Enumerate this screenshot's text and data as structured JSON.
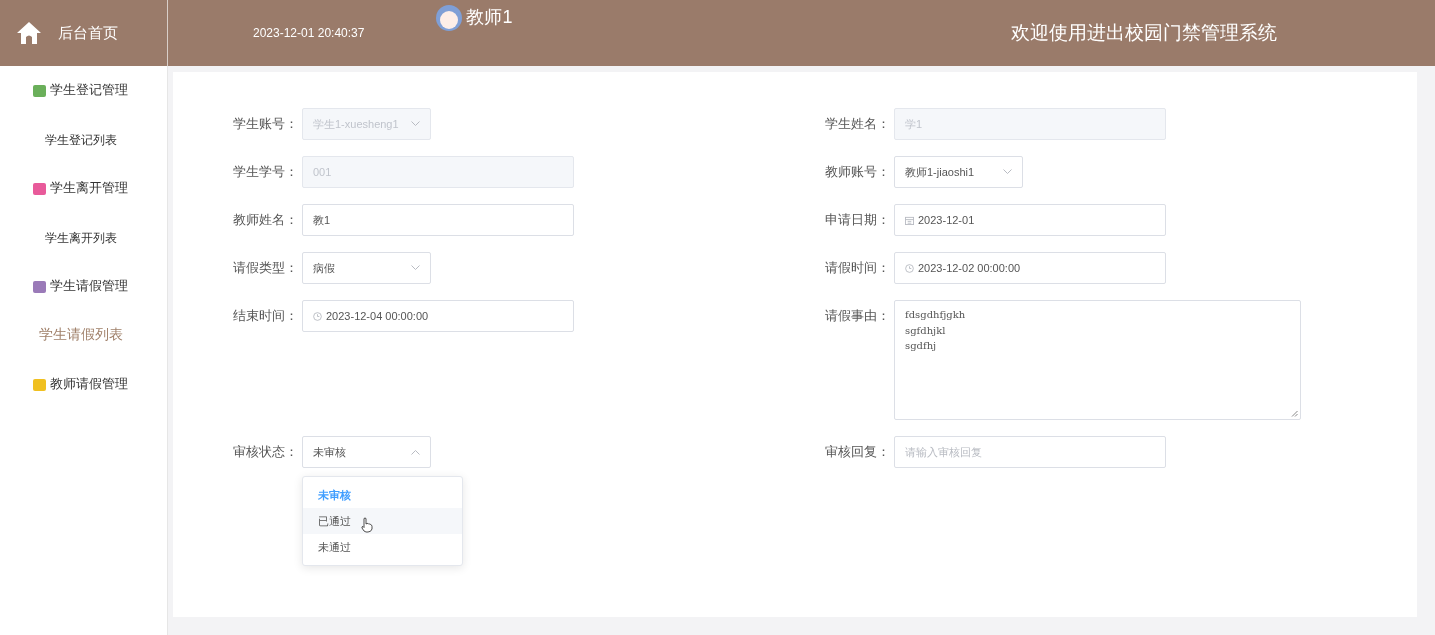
{
  "header": {
    "home_label": "后台首页",
    "datetime": "2023-12-01 20:40:37",
    "user": "教师1",
    "title": "欢迎使用进出校园门禁管理系统"
  },
  "sidebar": {
    "items": [
      {
        "label": "学生登记管理",
        "color": "#6aaf5a",
        "children": [
          {
            "label": "学生登记列表",
            "selected": false
          }
        ]
      },
      {
        "label": "学生离开管理",
        "color": "#e85a9a",
        "children": [
          {
            "label": "学生离开列表",
            "selected": false
          }
        ]
      },
      {
        "label": "学生请假管理",
        "color": "#9a7ab8",
        "children": [
          {
            "label": "学生请假列表",
            "selected": true
          }
        ]
      },
      {
        "label": "教师请假管理",
        "color": "#f0c020"
      }
    ]
  },
  "form": {
    "rows": [
      {
        "left": {
          "label": "学生账号：",
          "kind": "select",
          "value": "学生1-xuesheng1",
          "disabled": true
        },
        "right": {
          "label": "学生姓名：",
          "kind": "input",
          "value": "学1",
          "disabled": true
        }
      },
      {
        "left": {
          "label": "学生学号：",
          "kind": "input",
          "value": "001",
          "disabled": true
        },
        "right": {
          "label": "教师账号：",
          "kind": "select",
          "value": "教师1-jiaoshi1",
          "disabled": false
        }
      },
      {
        "left": {
          "label": "教师姓名：",
          "kind": "input",
          "value": "教1",
          "disabled": false
        },
        "right": {
          "label": "申请日期：",
          "kind": "date",
          "value": "2023-12-01",
          "disabled": false
        }
      },
      {
        "left": {
          "label": "请假类型：",
          "kind": "select",
          "value": "病假",
          "disabled": false
        },
        "right": {
          "label": "请假时间：",
          "kind": "datetime",
          "value": "2023-12-02 00:00:00",
          "disabled": false
        }
      },
      {
        "left": {
          "label": "结束时间：",
          "kind": "datetime",
          "value": "2023-12-04 00:00:00",
          "disabled": false
        },
        "right": {
          "label": "请假事由：",
          "kind": "textarea",
          "value": "fdsgdhfjgkh\nsgfdhjkl\nsgdfhj",
          "disabled": false
        }
      },
      {
        "left": {
          "label": "审核状态：",
          "kind": "select",
          "value": "未审核",
          "disabled": false,
          "expanded": true,
          "options": [
            {
              "label": "未审核",
              "selected": true,
              "hovered": false
            },
            {
              "label": "已通过",
              "selected": false,
              "hovered": true
            },
            {
              "label": "未通过",
              "selected": false,
              "hovered": false
            }
          ]
        },
        "right": {
          "label": "审核回复：",
          "kind": "input",
          "placeholder": "请输入审核回复"
        }
      }
    ]
  }
}
